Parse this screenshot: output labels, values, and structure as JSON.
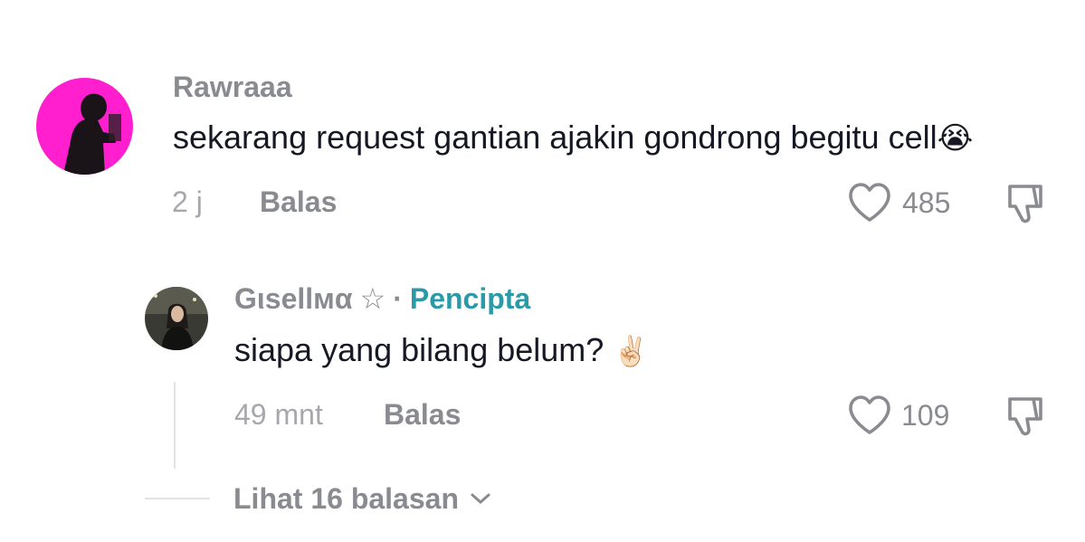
{
  "comment": {
    "username": "Rawraaa",
    "text": "sekarang request gantian ajakin gondrong begitu cell",
    "emoji": "😭",
    "time": "2 j",
    "reply_label": "Balas",
    "likes": "485",
    "icons": [
      "avatar",
      "heart-icon",
      "dislike-icon"
    ]
  },
  "reply": {
    "username": "Gιsellмα",
    "star": "☆",
    "separator": "·",
    "badge": "Pencipta",
    "text": "siapa yang bilang belum?",
    "emoji": "✌🏻",
    "time": "49 mnt",
    "reply_label": "Balas",
    "likes": "109",
    "icons": [
      "avatar",
      "heart-icon",
      "dislike-icon"
    ]
  },
  "view_replies": {
    "label": "Lihat 16 balasan",
    "icon": "chevron-down-icon"
  },
  "colors": {
    "muted_text": "#8a8b91",
    "light_text": "#a7a8ad",
    "creator_badge": "#2a9aa8",
    "avatar_main_bg": "#ff1fcf"
  }
}
